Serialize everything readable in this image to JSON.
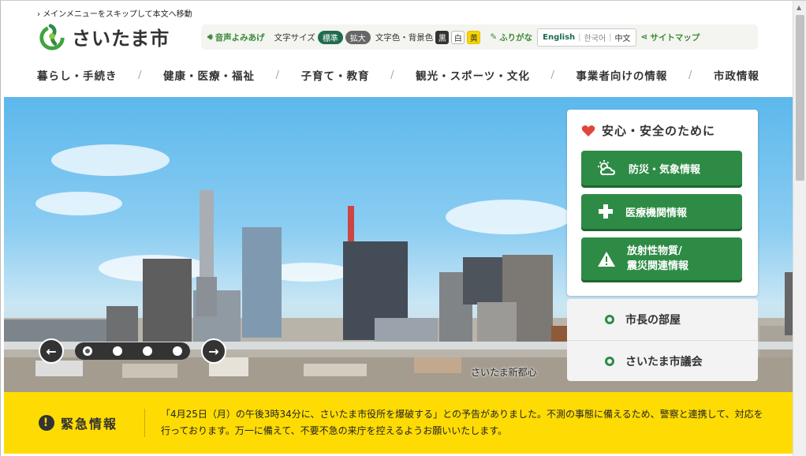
{
  "skip_link": "メインメニューをスキップして本文へ移動",
  "logo": {
    "text": "さいたま市"
  },
  "utility": {
    "voice": "音声よみあげ",
    "font_size_label": "文字サイズ",
    "font_standard": "標準",
    "font_large": "拡大",
    "color_label": "文字色・背景色",
    "color_black": "黒",
    "color_white": "白",
    "color_yellow": "黄",
    "furigana": "ふりがな",
    "lang_english": "English",
    "lang_korean": "한국어",
    "lang_chinese": "中文",
    "sitemap": "サイトマップ"
  },
  "nav": {
    "items": [
      "暮らし・手続き",
      "健康・医療・福祉",
      "子育て・教育",
      "観光・スポーツ・文化",
      "事業者向けの情報",
      "市政情報"
    ]
  },
  "hero": {
    "caption": "さいたま新都心",
    "prev_icon": "arrow-left-icon",
    "next_icon": "arrow-right-icon",
    "slide_count": 4,
    "active_slide": 1
  },
  "safety": {
    "title": "安心・安全のために",
    "buttons": [
      {
        "label": "防災・気象情報",
        "icon": "weather-icon"
      },
      {
        "label": "医療機関情報",
        "icon": "medical-cross-icon"
      },
      {
        "label_line1": "放射性物質/",
        "label_line2": "震災関連情報",
        "icon": "warning-icon"
      }
    ]
  },
  "quick_links": [
    "市長の部屋",
    "さいたま市議会"
  ],
  "emergency": {
    "title": "緊急情報",
    "message": "「4月25日（月）の午後3時34分に、さいたま市役所を爆破する」との予告がありました。不測の事態に備えるため、警察と連携して、対応を行っております。万一に備えて、不要不急の来庁を控えるようお願いいたします。"
  },
  "colors": {
    "green": "#2e8b45",
    "yellow": "#fedc03",
    "sky": "#5cb8ec"
  }
}
